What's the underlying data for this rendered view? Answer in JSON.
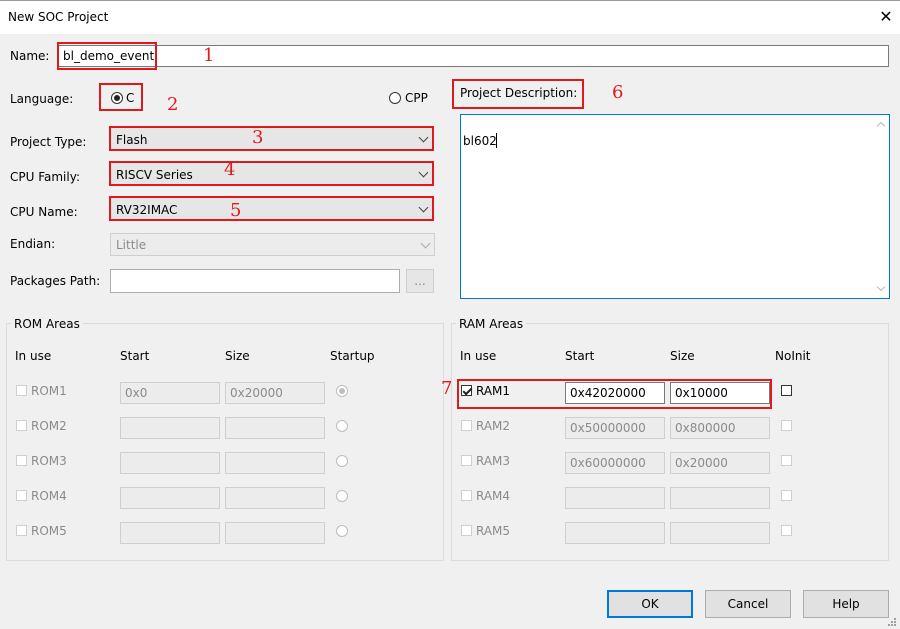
{
  "window": {
    "title": "New SOC Project",
    "close_glyph": "✕"
  },
  "fields": {
    "name_label": "Name:",
    "name_value": "bl_demo_event",
    "language_label": "Language:",
    "lang_c": "C",
    "lang_cpp": "CPP",
    "project_type_label": "Project Type:",
    "project_type_value": "Flash",
    "cpu_family_label": "CPU Family:",
    "cpu_family_value": "RISCV Series",
    "cpu_name_label": "CPU Name:",
    "cpu_name_value": "RV32IMAC",
    "endian_label": "Endian:",
    "endian_value": "Little",
    "packages_label": "Packages Path:",
    "browse_label": "...",
    "desc_label": "Project Description:",
    "desc_value": "bl602"
  },
  "annotations": [
    "1",
    "2",
    "3",
    "4",
    "5",
    "6",
    "7"
  ],
  "rom": {
    "title": "ROM Areas",
    "headers": {
      "inuse": "In use",
      "start": "Start",
      "size": "Size",
      "startup": "Startup"
    },
    "rows": [
      {
        "name": "ROM1",
        "start": "0x0",
        "size": "0x20000"
      },
      {
        "name": "ROM2",
        "start": "",
        "size": ""
      },
      {
        "name": "ROM3",
        "start": "",
        "size": ""
      },
      {
        "name": "ROM4",
        "start": "",
        "size": ""
      },
      {
        "name": "ROM5",
        "start": "",
        "size": ""
      }
    ]
  },
  "ram": {
    "title": "RAM Areas",
    "headers": {
      "inuse": "In use",
      "start": "Start",
      "size": "Size",
      "noinit": "NoInit"
    },
    "rows": [
      {
        "name": "RAM1",
        "start": "0x42020000",
        "size": "0x10000"
      },
      {
        "name": "RAM2",
        "start": "0x50000000",
        "size": "0x800000"
      },
      {
        "name": "RAM3",
        "start": "0x60000000",
        "size": "0x20000"
      },
      {
        "name": "RAM4",
        "start": "",
        "size": ""
      },
      {
        "name": "RAM5",
        "start": "",
        "size": ""
      }
    ]
  },
  "buttons": {
    "ok": "OK",
    "cancel": "Cancel",
    "help": "Help"
  },
  "colors": {
    "annotation": "#e0191e"
  }
}
